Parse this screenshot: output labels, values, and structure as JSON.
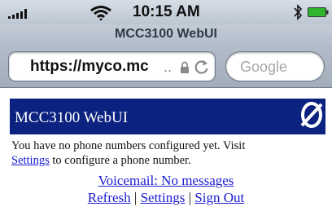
{
  "statusbar": {
    "time": "10:15 AM",
    "icons": [
      "signal-icon",
      "wifi-icon",
      "bluetooth-icon",
      "battery-icon"
    ]
  },
  "browser": {
    "title": "MCC3100 WebUI",
    "url": "https://myco.mc",
    "url_ellipsis": "..",
    "search_placeholder": "Google",
    "icons": [
      "lock-icon",
      "reload-icon"
    ]
  },
  "page": {
    "banner_title": "MCC3100 WebUI",
    "logo": "brand-logo-icon",
    "message_before_link": "You have no phone numbers configured yet.  Visit",
    "message_link": "Settings",
    "message_after_link": "to configure a phone number.",
    "voicemail_link": "Voicemail: No messages",
    "nav": {
      "refresh": "Refresh",
      "separator": "|",
      "settings": "Settings",
      "sign_out": "Sign Out"
    }
  },
  "colors": {
    "banner_background": "#0b2280",
    "link": "#1b1bd0"
  }
}
